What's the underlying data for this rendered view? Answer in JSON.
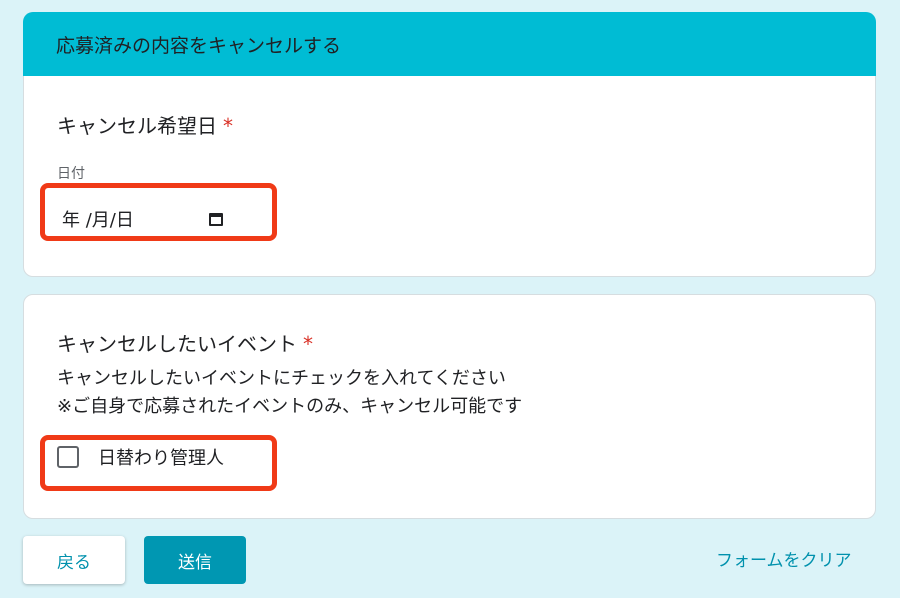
{
  "header": {
    "title": "応募済みの内容をキャンセルする"
  },
  "question_date": {
    "title": "キャンセル希望日",
    "required_mark": "*",
    "sub_label": "日付",
    "input_placeholder": "年 /月/日",
    "icon": "calendar-icon"
  },
  "question_event": {
    "title": "キャンセルしたいイベント",
    "required_mark": "*",
    "description_line1": "キャンセルしたいイベントにチェックを入れてください",
    "description_line2": "※ご自身で応募されたイベントのみ、キャンセル可能です",
    "options": [
      {
        "label": "日替わり管理人",
        "checked": false
      }
    ]
  },
  "buttons": {
    "back_label": "戻る",
    "submit_label": "送信",
    "clear_label": "フォームをクリア"
  },
  "colors": {
    "header_bg": "#00bcd4",
    "page_bg": "#dbf3f8",
    "accent": "#0097b2",
    "required": "#d93025",
    "highlight": "#f03a17"
  }
}
